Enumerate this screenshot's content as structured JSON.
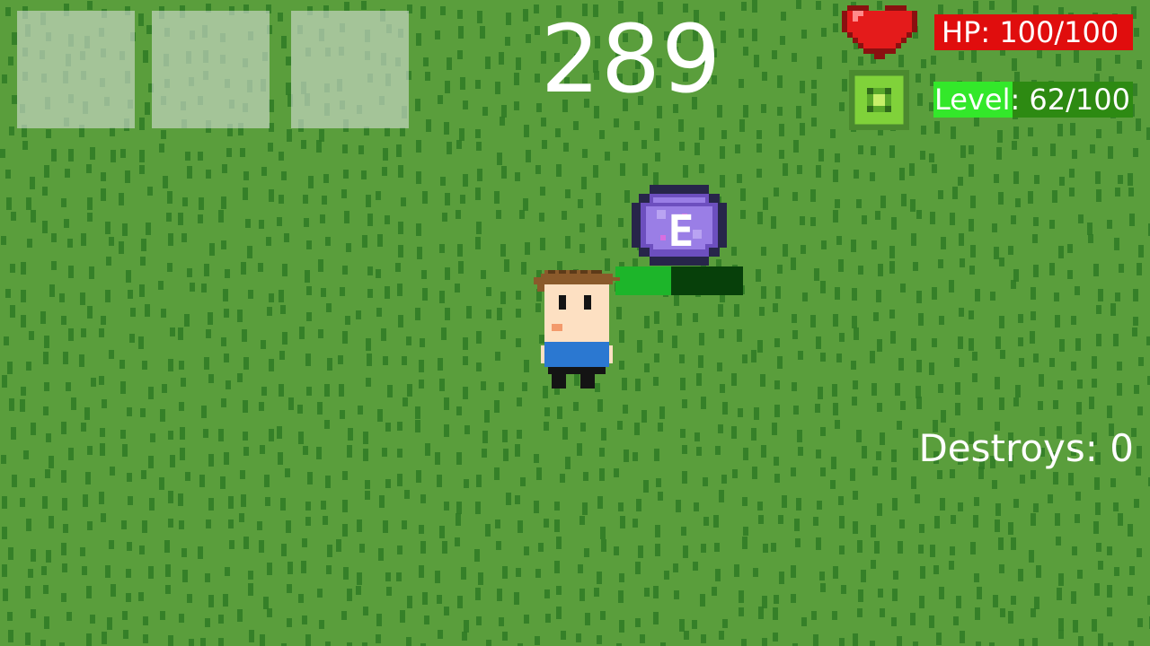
{
  "hud": {
    "score": "289",
    "hp_text": "HP: 100/100",
    "level_text": "Level: 62/100",
    "level_progress": 0.62,
    "destroys_text": "Destroys: 0",
    "inventory_slots": 3,
    "icons": {
      "heart": "heart-icon",
      "level": "level-gem-icon"
    }
  },
  "world": {
    "enemy": {
      "letter": "E",
      "health_fraction": 0.44
    }
  },
  "colors": {
    "grass": "#5a9e3c",
    "grass_blade": "#2f7a24",
    "hp_panel": "#e00d0d",
    "level_fill": "#33e82a",
    "level_track": "#2d8a12",
    "enemy_health": "#1db52a",
    "enemy_health_track": "#07400a"
  }
}
